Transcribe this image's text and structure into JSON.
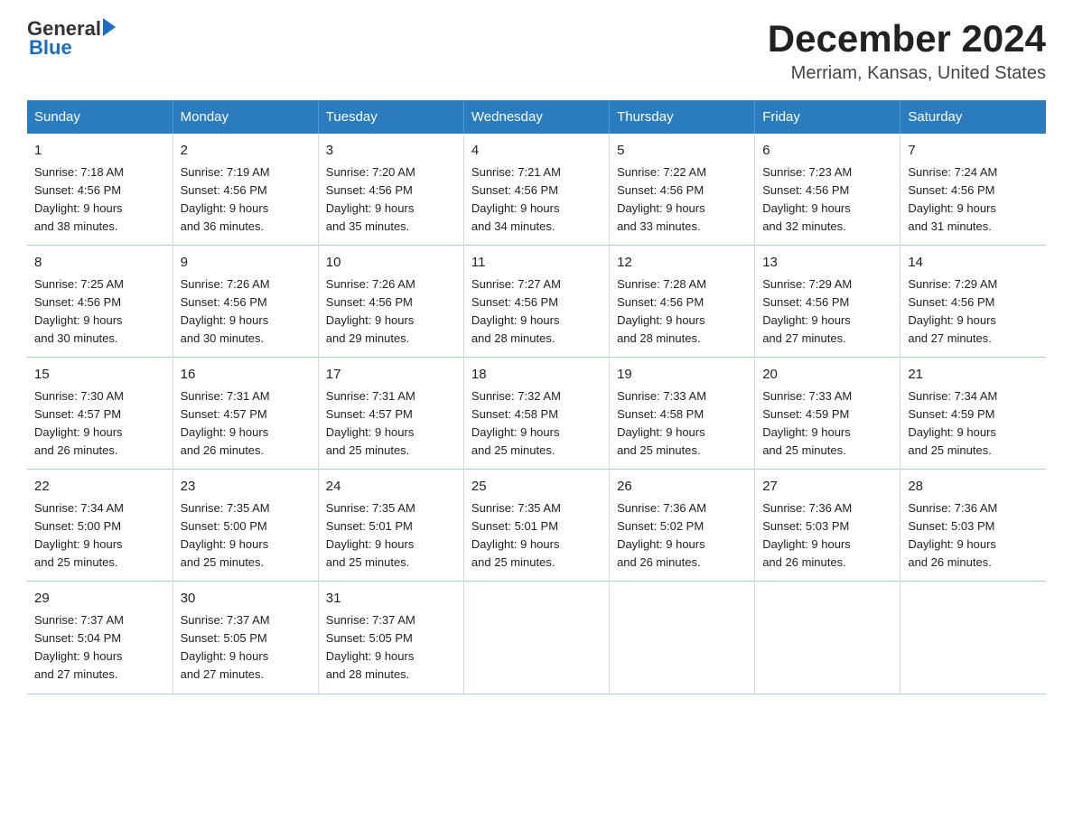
{
  "header": {
    "title": "December 2024",
    "subtitle": "Merriam, Kansas, United States",
    "logo_general": "General",
    "logo_blue": "Blue"
  },
  "days_of_week": [
    "Sunday",
    "Monday",
    "Tuesday",
    "Wednesday",
    "Thursday",
    "Friday",
    "Saturday"
  ],
  "weeks": [
    [
      {
        "day": "1",
        "sunrise": "7:18 AM",
        "sunset": "4:56 PM",
        "daylight": "9 hours and 38 minutes."
      },
      {
        "day": "2",
        "sunrise": "7:19 AM",
        "sunset": "4:56 PM",
        "daylight": "9 hours and 36 minutes."
      },
      {
        "day": "3",
        "sunrise": "7:20 AM",
        "sunset": "4:56 PM",
        "daylight": "9 hours and 35 minutes."
      },
      {
        "day": "4",
        "sunrise": "7:21 AM",
        "sunset": "4:56 PM",
        "daylight": "9 hours and 34 minutes."
      },
      {
        "day": "5",
        "sunrise": "7:22 AM",
        "sunset": "4:56 PM",
        "daylight": "9 hours and 33 minutes."
      },
      {
        "day": "6",
        "sunrise": "7:23 AM",
        "sunset": "4:56 PM",
        "daylight": "9 hours and 32 minutes."
      },
      {
        "day": "7",
        "sunrise": "7:24 AM",
        "sunset": "4:56 PM",
        "daylight": "9 hours and 31 minutes."
      }
    ],
    [
      {
        "day": "8",
        "sunrise": "7:25 AM",
        "sunset": "4:56 PM",
        "daylight": "9 hours and 30 minutes."
      },
      {
        "day": "9",
        "sunrise": "7:26 AM",
        "sunset": "4:56 PM",
        "daylight": "9 hours and 30 minutes."
      },
      {
        "day": "10",
        "sunrise": "7:26 AM",
        "sunset": "4:56 PM",
        "daylight": "9 hours and 29 minutes."
      },
      {
        "day": "11",
        "sunrise": "7:27 AM",
        "sunset": "4:56 PM",
        "daylight": "9 hours and 28 minutes."
      },
      {
        "day": "12",
        "sunrise": "7:28 AM",
        "sunset": "4:56 PM",
        "daylight": "9 hours and 28 minutes."
      },
      {
        "day": "13",
        "sunrise": "7:29 AM",
        "sunset": "4:56 PM",
        "daylight": "9 hours and 27 minutes."
      },
      {
        "day": "14",
        "sunrise": "7:29 AM",
        "sunset": "4:56 PM",
        "daylight": "9 hours and 27 minutes."
      }
    ],
    [
      {
        "day": "15",
        "sunrise": "7:30 AM",
        "sunset": "4:57 PM",
        "daylight": "9 hours and 26 minutes."
      },
      {
        "day": "16",
        "sunrise": "7:31 AM",
        "sunset": "4:57 PM",
        "daylight": "9 hours and 26 minutes."
      },
      {
        "day": "17",
        "sunrise": "7:31 AM",
        "sunset": "4:57 PM",
        "daylight": "9 hours and 25 minutes."
      },
      {
        "day": "18",
        "sunrise": "7:32 AM",
        "sunset": "4:58 PM",
        "daylight": "9 hours and 25 minutes."
      },
      {
        "day": "19",
        "sunrise": "7:33 AM",
        "sunset": "4:58 PM",
        "daylight": "9 hours and 25 minutes."
      },
      {
        "day": "20",
        "sunrise": "7:33 AM",
        "sunset": "4:59 PM",
        "daylight": "9 hours and 25 minutes."
      },
      {
        "day": "21",
        "sunrise": "7:34 AM",
        "sunset": "4:59 PM",
        "daylight": "9 hours and 25 minutes."
      }
    ],
    [
      {
        "day": "22",
        "sunrise": "7:34 AM",
        "sunset": "5:00 PM",
        "daylight": "9 hours and 25 minutes."
      },
      {
        "day": "23",
        "sunrise": "7:35 AM",
        "sunset": "5:00 PM",
        "daylight": "9 hours and 25 minutes."
      },
      {
        "day": "24",
        "sunrise": "7:35 AM",
        "sunset": "5:01 PM",
        "daylight": "9 hours and 25 minutes."
      },
      {
        "day": "25",
        "sunrise": "7:35 AM",
        "sunset": "5:01 PM",
        "daylight": "9 hours and 25 minutes."
      },
      {
        "day": "26",
        "sunrise": "7:36 AM",
        "sunset": "5:02 PM",
        "daylight": "9 hours and 26 minutes."
      },
      {
        "day": "27",
        "sunrise": "7:36 AM",
        "sunset": "5:03 PM",
        "daylight": "9 hours and 26 minutes."
      },
      {
        "day": "28",
        "sunrise": "7:36 AM",
        "sunset": "5:03 PM",
        "daylight": "9 hours and 26 minutes."
      }
    ],
    [
      {
        "day": "29",
        "sunrise": "7:37 AM",
        "sunset": "5:04 PM",
        "daylight": "9 hours and 27 minutes."
      },
      {
        "day": "30",
        "sunrise": "7:37 AM",
        "sunset": "5:05 PM",
        "daylight": "9 hours and 27 minutes."
      },
      {
        "day": "31",
        "sunrise": "7:37 AM",
        "sunset": "5:05 PM",
        "daylight": "9 hours and 28 minutes."
      },
      null,
      null,
      null,
      null
    ]
  ],
  "labels": {
    "sunrise": "Sunrise:",
    "sunset": "Sunset:",
    "daylight": "Daylight:"
  }
}
